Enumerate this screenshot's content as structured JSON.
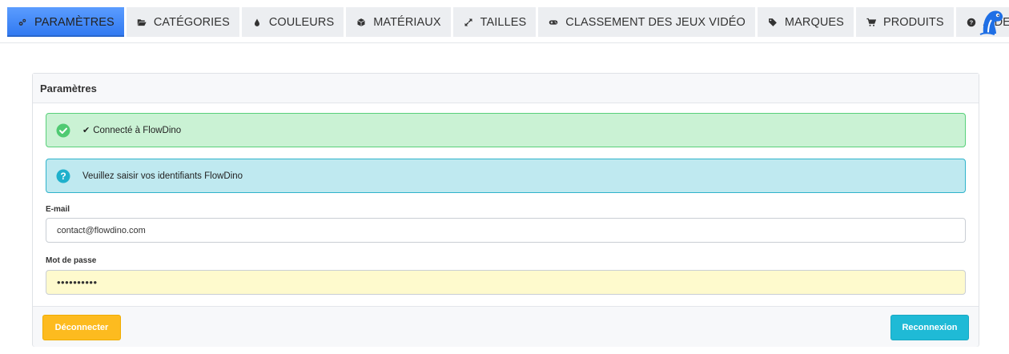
{
  "nav": {
    "tabs": [
      {
        "label": "PARAMÈTRES",
        "icon": "cogs-icon",
        "active": true
      },
      {
        "label": "CATÉGORIES",
        "icon": "folder-open-icon",
        "active": false
      },
      {
        "label": "COULEURS",
        "icon": "tint-icon",
        "active": false
      },
      {
        "label": "MATÉRIAUX",
        "icon": "cube-icon",
        "active": false
      },
      {
        "label": "TAILLES",
        "icon": "expand-icon",
        "active": false
      },
      {
        "label": "CLASSEMENT DES JEUX VIDÉO",
        "icon": "gamepad-icon",
        "active": false
      },
      {
        "label": "MARQUES",
        "icon": "tag-icon",
        "active": false
      },
      {
        "label": "PRODUITS",
        "icon": "shopping-cart-icon",
        "active": false
      },
      {
        "label": "AIDE",
        "icon": "question-circle-icon",
        "active": false
      }
    ],
    "logo": "flowdino-dino-logo"
  },
  "card": {
    "title": "Paramètres",
    "success_alert": "Connecté à FlowDino",
    "info_alert": "Veuillez saisir vos identifiants FlowDino",
    "email_label": "E-mail",
    "email_value": "contact@flowdino.com",
    "password_label": "Mot de passe",
    "password_value": "••••••••••",
    "disconnect_button": "Déconnecter",
    "reconnect_button": "Reconnexion"
  },
  "colors": {
    "active_tab": "#3d86f7",
    "success_bg": "#caf2d4",
    "success_accent": "#58d07a",
    "info_bg": "#bfe9f0",
    "info_accent": "#2fb3cb",
    "warning_button": "#fdbb1f",
    "info_button": "#1fbad6",
    "password_bg": "#fefacd"
  }
}
